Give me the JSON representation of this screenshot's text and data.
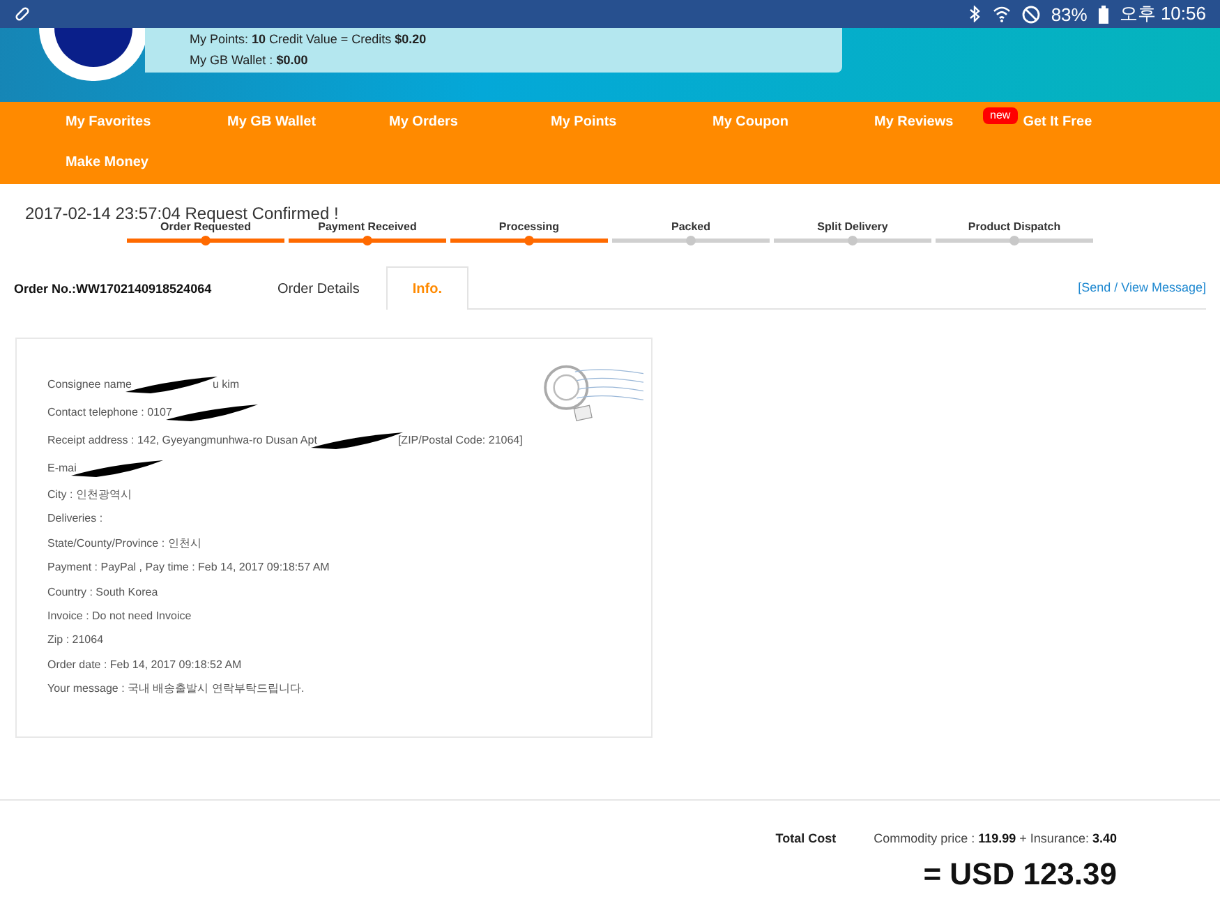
{
  "status_bar": {
    "battery": "83%",
    "time": "오후 10:56"
  },
  "account": {
    "points_line": "My Points: **10** Credit Value = Credits **$0.20**",
    "wallet_label": "My GB Wallet :",
    "wallet_value": "$0.00"
  },
  "nav": [
    {
      "label": "My Favorites"
    },
    {
      "label": "My GB Wallet"
    },
    {
      "label": "My Orders"
    },
    {
      "label": "My Points"
    },
    {
      "label": "My Coupon"
    },
    {
      "label": "My Reviews"
    },
    {
      "label": "Get It Free",
      "badge": "new"
    },
    {
      "label": "Make Money"
    }
  ],
  "status_note": "2017-02-14 23:57:04 Request Confirmed !",
  "steps": [
    {
      "label": "Order Requested",
      "done": true
    },
    {
      "label": "Payment Received",
      "done": true
    },
    {
      "label": "Processing",
      "done": true
    },
    {
      "label": "Packed",
      "done": false
    },
    {
      "label": "Split Delivery",
      "done": false
    },
    {
      "label": "Product Dispatch",
      "done": false
    }
  ],
  "order_no": "Order No.:WW1702140918524064",
  "tabs": [
    {
      "label": "Order Details",
      "selected": false
    },
    {
      "label": "Info.",
      "selected": true
    }
  ],
  "message_link": "[Send / View Message]",
  "info_lines": [
    {
      "before": "Consignee name",
      "redacted": true,
      "after": "u kim"
    },
    {
      "before": "Contact telephone : 0107",
      "redacted": true
    },
    {
      "before": "Receipt address : 142, Gyeyangmunhwa-ro Dusan Apt",
      "redacted": true,
      "after": "[ZIP/Postal Code: 21064]"
    },
    {
      "before": "E-mai",
      "redacted": true
    },
    {
      "before": "City : 인천광역시",
      "redacted": false
    },
    {
      "before": "Deliveries :",
      "redacted": false
    },
    {
      "before": "State/County/Province : 인천시",
      "redacted": false
    },
    {
      "before": "Payment : PayPal , Pay time : Feb 14, 2017 09:18:57 AM",
      "redacted": false
    },
    {
      "before": "Country : South Korea",
      "redacted": false
    },
    {
      "before": "Invoice : Do not need Invoice",
      "redacted": false
    },
    {
      "before": "Zip : 21064",
      "redacted": false
    },
    {
      "before": "Order date : Feb 14, 2017 09:18:52 AM",
      "redacted": false
    },
    {
      "before": "Your message : 국내 배송출발시 연락부탁드립니다.",
      "redacted": false
    }
  ],
  "totals": {
    "label": "Total Cost",
    "breakdown": "Commodity price :  **119.99** + Insurance: **3.40**",
    "total": "= USD 123.39"
  }
}
